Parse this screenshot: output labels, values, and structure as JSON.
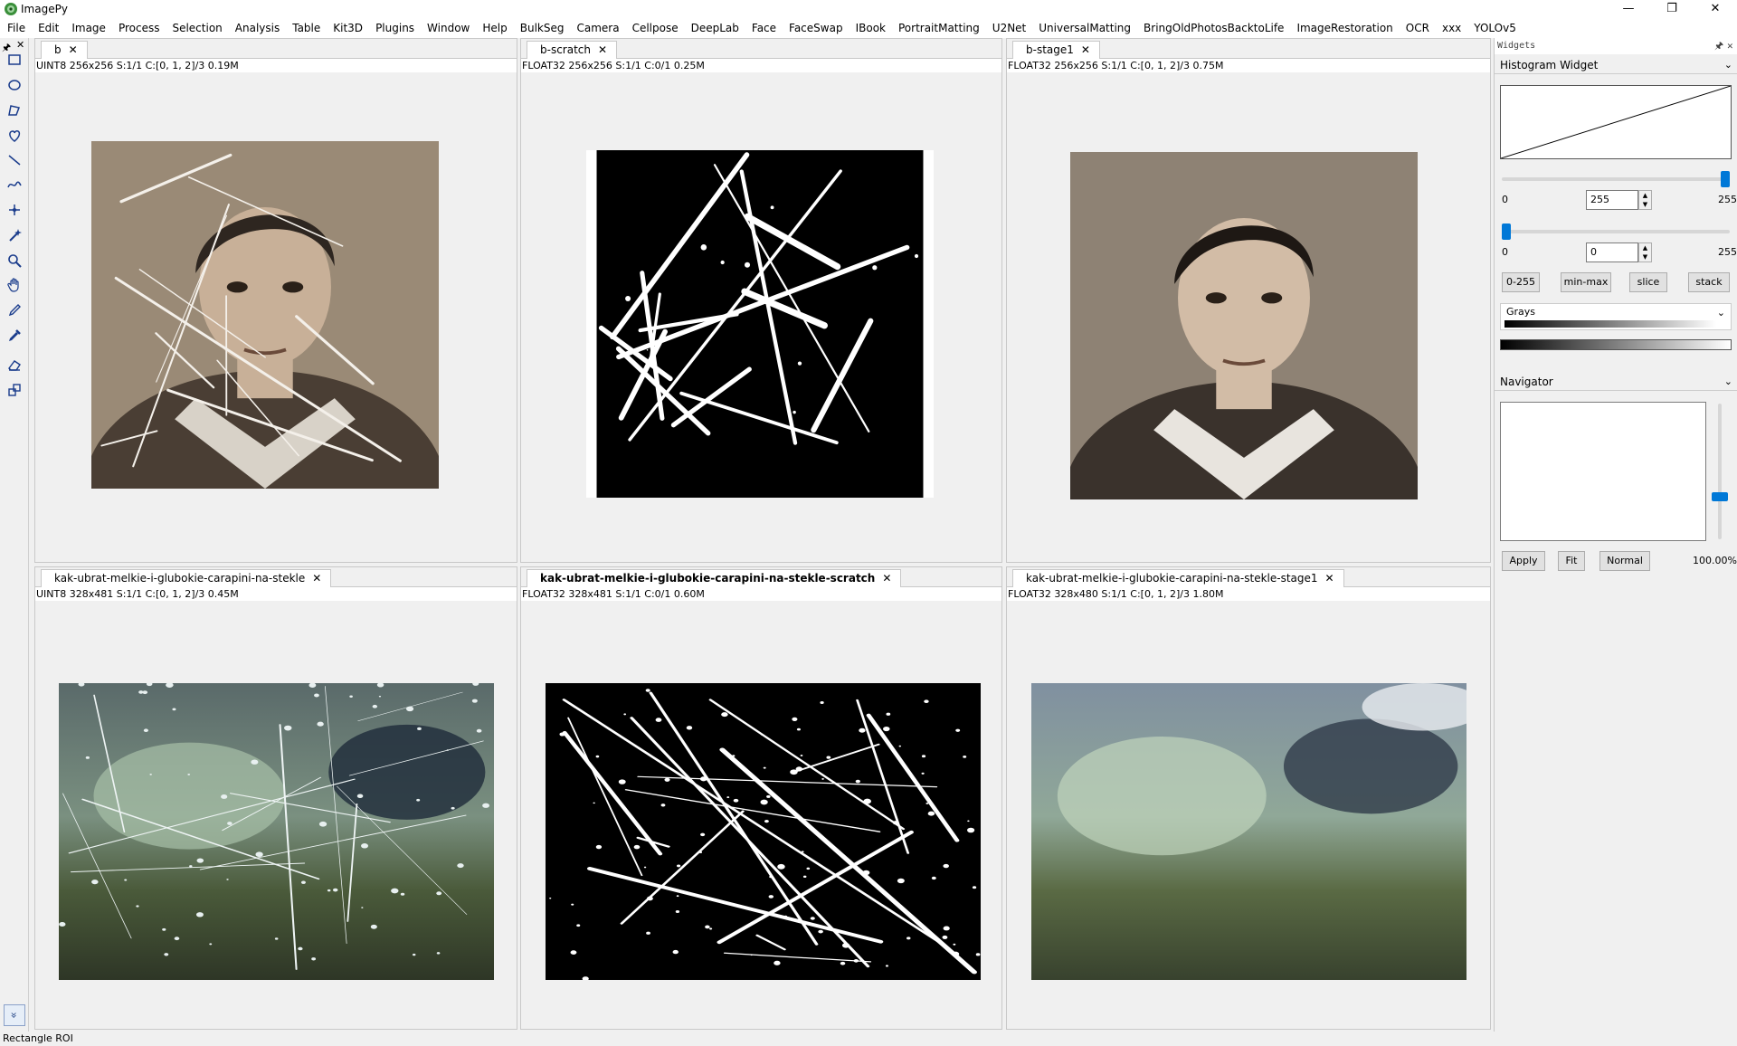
{
  "app": {
    "title": "ImagePy"
  },
  "window_buttons": {
    "minimize": "—",
    "maximize": "❐",
    "close": "✕"
  },
  "menubar": [
    "File",
    "Edit",
    "Image",
    "Process",
    "Selection",
    "Analysis",
    "Table",
    "Kit3D",
    "Plugins",
    "Window",
    "Help",
    "BulkSeg",
    "Camera",
    "Cellpose",
    "DeepLab",
    "Face",
    "FaceSwap",
    "IBook",
    "PortraitMatting",
    "U2Net",
    "UniversalMatting",
    "BringOldPhotosBacktoLife",
    "ImageRestoration",
    "OCR",
    "xxx",
    "YOLOv5"
  ],
  "toolbar": {
    "pin": "🖈",
    "close": "✕",
    "tools": [
      "rectangle-tool-icon",
      "ellipse-tool-icon",
      "polygon-tool-icon",
      "freehand-tool-icon",
      "line-tool-icon",
      "polyline-tool-icon",
      "point-tool-icon",
      "magic-wand-tool-icon",
      "zoom-tool-icon",
      "hand-tool-icon",
      "pencil-tool-icon",
      "color-picker-tool-icon",
      "eraser-tool-icon",
      "transform-tool-icon"
    ],
    "more": "»"
  },
  "panels": [
    {
      "tab": "b",
      "info": "UINT8  256x256  S:1/1  C:[0, 1, 2]/3  0.19M",
      "kind": "photo-old"
    },
    {
      "tab": "b-scratch",
      "info": "FLOAT32  256x256  S:1/1  C:0/1  0.25M",
      "kind": "mask"
    },
    {
      "tab": "b-stage1",
      "info": "FLOAT32  256x256  S:1/1  C:[0, 1, 2]/3  0.75M",
      "kind": "photo-restored"
    },
    {
      "tab": "kak-ubrat-melkie-i-glubokie-carapini-na-stekle",
      "info": "UINT8  328x481  S:1/1  C:[0, 1, 2]/3  0.45M",
      "kind": "glass-scratched"
    },
    {
      "tab": "kak-ubrat-melkie-i-glubokie-carapini-na-stekle-scratch",
      "info": "FLOAT32  328x481  S:1/1  C:0/1  0.60M",
      "kind": "glass-mask"
    },
    {
      "tab": "kak-ubrat-melkie-i-glubokie-carapini-na-stekle-stage1",
      "info": "FLOAT32  328x480  S:1/1  C:[0, 1, 2]/3  1.80M",
      "kind": "glass-restored"
    }
  ],
  "active_tab_index": 4,
  "tab_close": "✕",
  "widgets": {
    "header": "Widgets",
    "pin": "🖈",
    "close": "✕",
    "histogram": {
      "title": "Histogram Widget",
      "high": {
        "min_label": "0",
        "value": "255",
        "max_label": "255",
        "level": 1.0
      },
      "low": {
        "min_label": "0",
        "value": "0",
        "max_label": "255",
        "level": 0.0
      },
      "buttons": [
        "0-255",
        "min-max",
        "slice",
        "stack"
      ],
      "lut": "Grays"
    },
    "navigator": {
      "title": "Navigator",
      "buttons": [
        "Apply",
        "Fit",
        "Normal"
      ],
      "zoom": "100.00%",
      "slider_level": 0.3
    }
  },
  "status": "Rectangle ROI"
}
